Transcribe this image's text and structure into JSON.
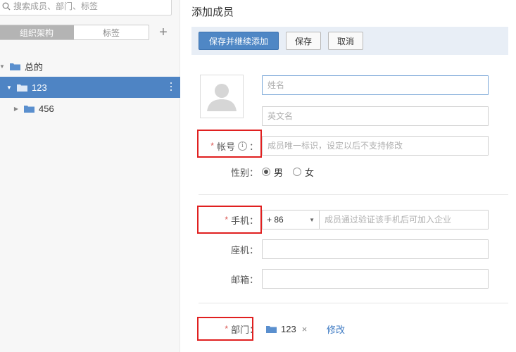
{
  "sidebar": {
    "search_placeholder": "搜索成员、部门、标签",
    "tabs": [
      {
        "label": "组织架构",
        "active": true
      },
      {
        "label": "标签",
        "active": false
      }
    ],
    "add_symbol": "+",
    "tree": [
      {
        "label": "总的",
        "expanded": true,
        "caret": "▼"
      },
      {
        "label": "123",
        "expanded": true,
        "selected": true,
        "caret": "▼"
      },
      {
        "label": "456",
        "expanded": false,
        "caret": "▶"
      }
    ]
  },
  "main": {
    "title": "添加成员",
    "toolbar": {
      "save_and_continue": "保存并继续添加",
      "save": "保存",
      "cancel": "取消"
    },
    "form": {
      "name_placeholder": "姓名",
      "english_name_placeholder": "英文名",
      "account_label": "帐号",
      "account_info_symbol": "i",
      "account_colon": "：",
      "account_placeholder": "成员唯一标识，设定以后不支持修改",
      "gender_label": "性别：",
      "gender_options": [
        {
          "label": "男",
          "checked": true
        },
        {
          "label": "女",
          "checked": false
        }
      ],
      "mobile_label": "手机：",
      "mobile_code": "+ 86",
      "mobile_placeholder": "成员通过验证该手机后可加入企业",
      "landline_label": "座机：",
      "email_label": "邮箱：",
      "department_label": "部门：",
      "department_value": "123",
      "department_remove": "×",
      "modify_link": "修改",
      "required_mark": "*"
    }
  },
  "colors": {
    "primary": "#4f87c5",
    "selected_row": "#4e84c4",
    "toolbar_bg": "#e8eef6",
    "highlight": "#e02020",
    "folder": "#5a8fce"
  }
}
